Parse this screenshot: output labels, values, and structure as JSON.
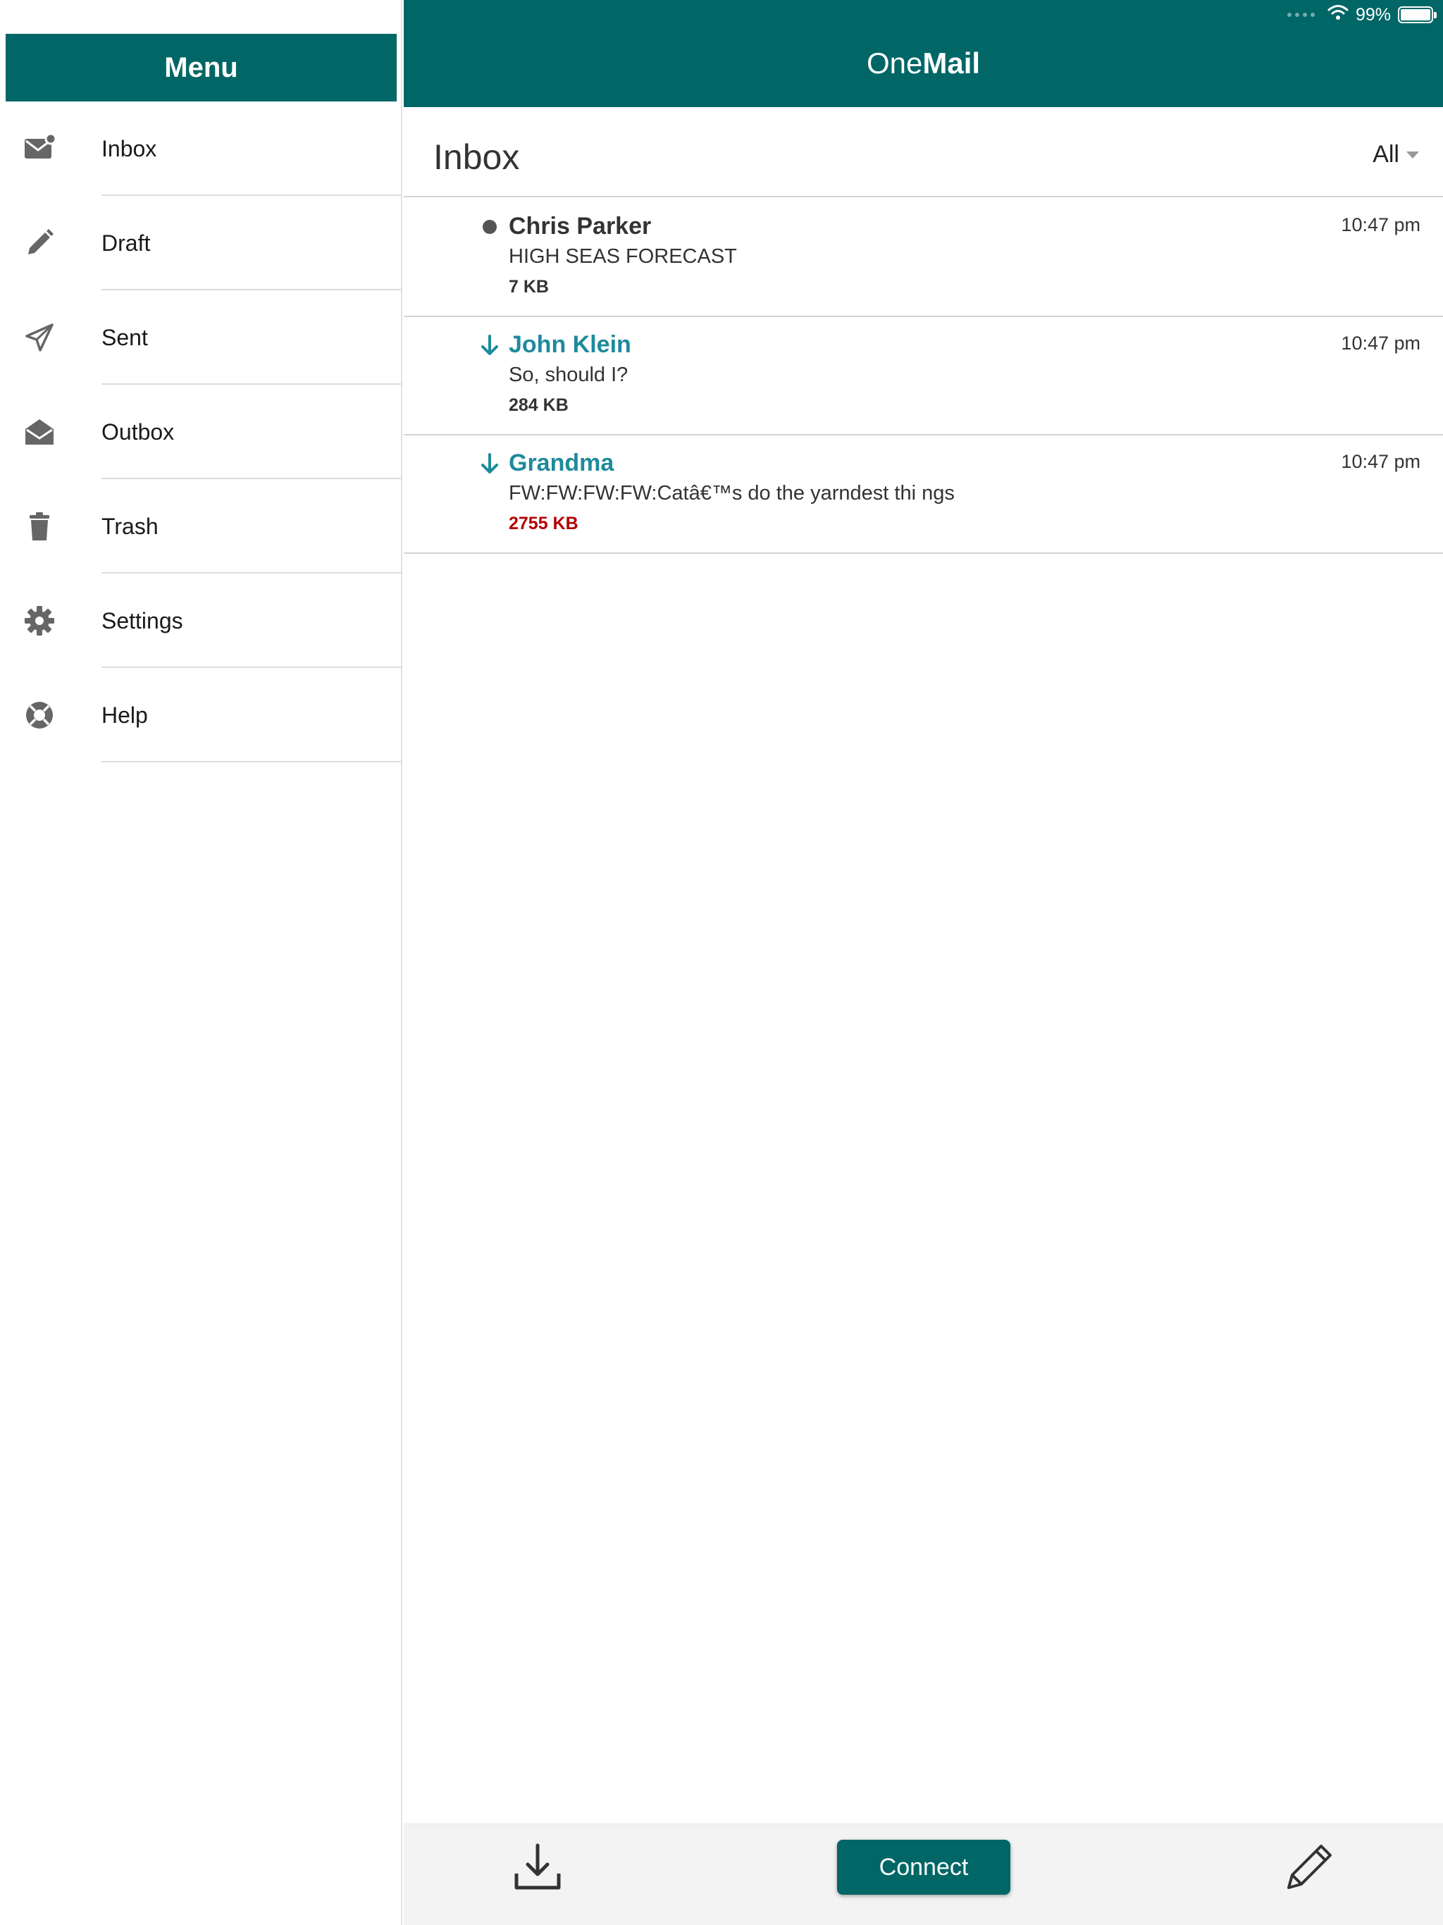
{
  "status_bar": {
    "battery": "99%",
    "battery_level": 0.99,
    "icons": [
      "signal-dots-icon",
      "wifi-icon",
      "battery-icon"
    ]
  },
  "sidebar": {
    "title": "Menu",
    "items": [
      {
        "label": "Inbox",
        "icon": "mail-icon"
      },
      {
        "label": "Draft",
        "icon": "pencil-icon"
      },
      {
        "label": "Sent",
        "icon": "paper-plane-icon"
      },
      {
        "label": "Outbox",
        "icon": "open-envelope-icon"
      },
      {
        "label": "Trash",
        "icon": "trash-icon"
      },
      {
        "label": "Settings",
        "icon": "gear-icon"
      },
      {
        "label": "Help",
        "icon": "lifebuoy-icon"
      }
    ]
  },
  "header": {
    "title_light": "One",
    "title_bold": "Mail"
  },
  "inbox": {
    "title": "Inbox",
    "filter": "All",
    "messages": [
      {
        "sender": "Chris Parker",
        "subject": "HIGH SEAS FORECAST",
        "size": "7 KB",
        "time": "10:47 pm",
        "marker": "unread-dot-icon"
      },
      {
        "sender": "John Klein",
        "subject": "So, should I?",
        "size": "284 KB",
        "time": "10:47 pm",
        "marker": "down-arrow-icon"
      },
      {
        "sender": "Grandma",
        "subject": "FW:FW:FW:FW:Catâ€™s do the yarndest thi ngs",
        "size": "2755 KB",
        "time": "10:47 pm",
        "marker": "down-arrow-icon"
      }
    ]
  },
  "bottom_bar": {
    "connect_label": "Connect",
    "icons": [
      "download-icon",
      "compose-icon"
    ]
  },
  "colors": {
    "brand": "#006666",
    "sender_accent": "#1f8a9c",
    "large_size": "#b30000"
  }
}
